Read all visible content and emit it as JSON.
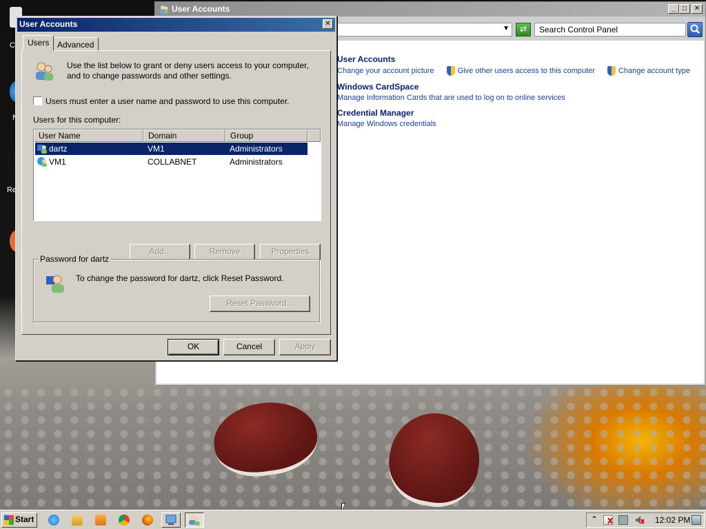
{
  "colors": {
    "title_active": "#0a246a",
    "title_inactive": "#8d8d8d",
    "link": "#1c3ea8",
    "heading": "#0b1e6e",
    "selection": "#0a246a",
    "face": "#d4d0c8"
  },
  "desktop": {
    "icon_labels": [
      "C",
      "N",
      "Re"
    ]
  },
  "control_panel": {
    "title": "User Accounts",
    "search_placeholder": "Search Control Panel",
    "minimize_label": "_",
    "maximize_label": "□",
    "close_label": "✕",
    "go_label": "⇄",
    "sections": [
      {
        "heading": "User Accounts",
        "links": [
          "Change your account picture",
          "Give other users access to this computer",
          "Change account type"
        ]
      },
      {
        "heading": "Windows CardSpace",
        "links": [
          "Manage Information Cards that are used to log on to online services"
        ]
      },
      {
        "heading": "Credential Manager",
        "links": [
          "Manage Windows credentials"
        ]
      }
    ]
  },
  "dialog": {
    "title": "User Accounts",
    "close_label": "✕",
    "tabs": [
      "Users",
      "Advanced"
    ],
    "intro_line1": "Use the list below to grant or deny users access to your computer,",
    "intro_line2": "and to change passwords and other settings.",
    "must_login_label": "Users must enter a user name and password to use this computer.",
    "users_label": "Users for this computer:",
    "columns": [
      "User Name",
      "Domain",
      "Group"
    ],
    "users": [
      {
        "name": "dartz",
        "domain": "VM1",
        "group": "Administrators",
        "selected": true
      },
      {
        "name": "VM1",
        "domain": "COLLABNET",
        "group": "Administrators",
        "selected": false
      }
    ],
    "add_label": "Add...",
    "remove_label": "Remove",
    "properties_label": "Properties",
    "password_group_label": "Password for dartz",
    "password_text": "To change the password for dartz, click Reset Password.",
    "reset_label": "Reset Password...",
    "ok_label": "OK",
    "cancel_label": "Cancel",
    "apply_label": "Apply"
  },
  "taskbar": {
    "start_label": "Start",
    "quicklaunch_icons": [
      "ie-icon",
      "explorer-icon",
      "media-player-icon",
      "chrome-icon",
      "firefox-icon"
    ],
    "tray_icons": [
      "show-hidden-icon",
      "action-center-icon",
      "network-icon",
      "volume-muted-icon"
    ],
    "clock": "12:02 PM"
  }
}
